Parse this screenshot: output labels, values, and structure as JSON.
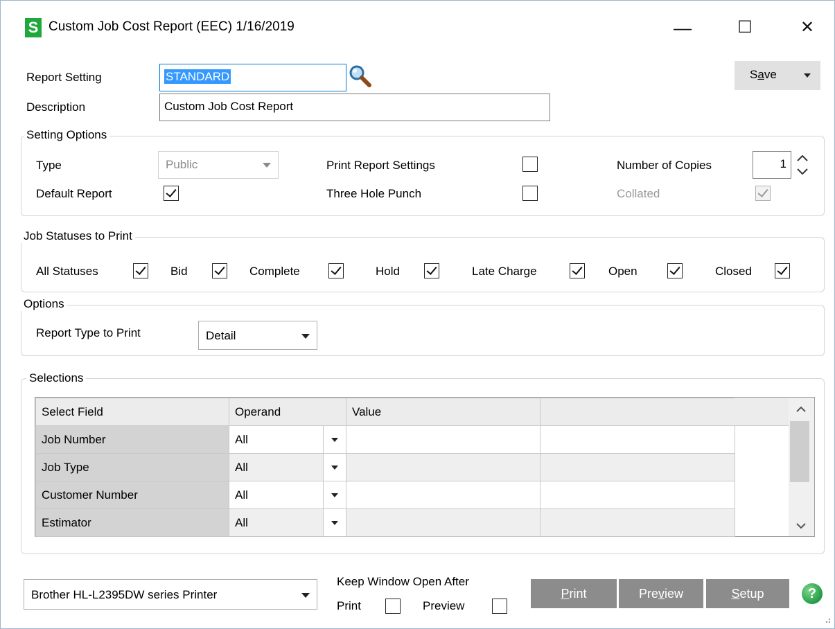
{
  "window": {
    "logo": "S",
    "title": "Custom Job Cost Report (EEC) 1/16/2019",
    "controls": {
      "minimize": "—",
      "maximize": "☐",
      "close": "✕"
    }
  },
  "header": {
    "report_setting_label": "Report Setting",
    "report_setting_value": "STANDARD",
    "description_label": "Description",
    "description_value": "Custom Job Cost Report",
    "save_pre": "S",
    "save_u": "a",
    "save_post": "ve"
  },
  "setting_options": {
    "title": "Setting Options",
    "type_label": "Type",
    "type_value": "Public",
    "default_report_label": "Default Report",
    "default_report_checked": true,
    "print_report_settings_label": "Print Report Settings",
    "print_report_settings_checked": false,
    "three_hole_punch_label": "Three Hole Punch",
    "three_hole_punch_checked": false,
    "copies_label": "Number of Copies",
    "copies_value": "1",
    "collated_label": "Collated",
    "collated_checked": true
  },
  "job_statuses": {
    "title": "Job Statuses to Print",
    "items": [
      {
        "label": "All Statuses",
        "checked": true
      },
      {
        "label": "Bid",
        "checked": true
      },
      {
        "label": "Complete",
        "checked": true
      },
      {
        "label": "Hold",
        "checked": true
      },
      {
        "label": "Late Charge",
        "checked": true
      },
      {
        "label": "Open",
        "checked": true
      },
      {
        "label": "Closed",
        "checked": true
      }
    ]
  },
  "options": {
    "title": "Options",
    "report_type_label": "Report Type to Print",
    "report_type_value": "Detail"
  },
  "selections": {
    "title": "Selections",
    "columns": [
      "Select Field",
      "Operand",
      "Value",
      ""
    ],
    "rows": [
      {
        "field": "Job Number",
        "operand": "All",
        "value": ""
      },
      {
        "field": "Job Type",
        "operand": "All",
        "value": ""
      },
      {
        "field": "Customer Number",
        "operand": "All",
        "value": ""
      },
      {
        "field": "Estimator",
        "operand": "All",
        "value": ""
      }
    ]
  },
  "footer": {
    "printer": "Brother HL-L2395DW series Printer",
    "keep_open_label": "Keep Window Open After",
    "print_label": "Print",
    "print_checked": false,
    "preview_label": "Preview",
    "preview_checked": false,
    "print_btn_pre": "",
    "print_btn_u": "P",
    "print_btn_post": "rint",
    "preview_btn_pre": "Pre",
    "preview_btn_u": "v",
    "preview_btn_post": "iew",
    "setup_btn_pre": "",
    "setup_btn_u": "S",
    "setup_btn_post": "etup",
    "help": "?"
  },
  "colors": {
    "logo": "#1fa83b",
    "selection_highlight": "#3399ff",
    "button_bg": "#8c8c8c",
    "help_icon": "#2ea44f"
  }
}
